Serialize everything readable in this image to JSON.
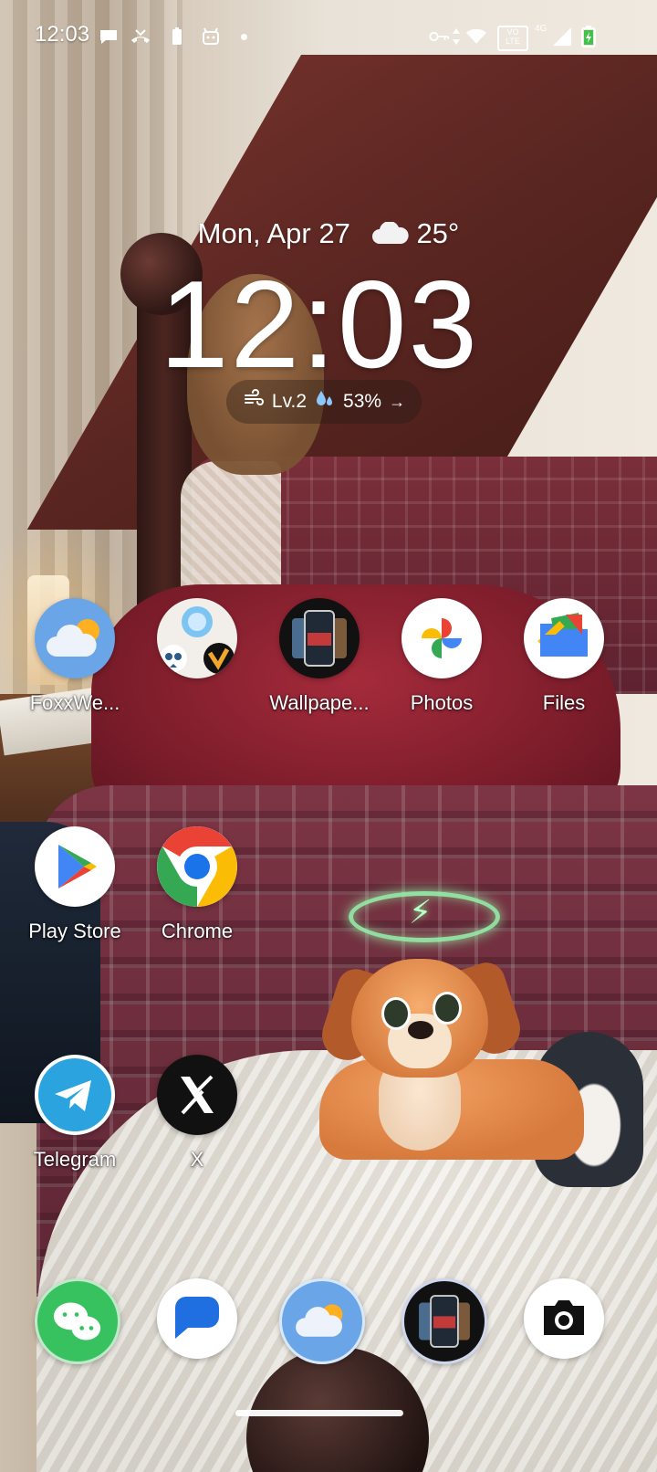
{
  "status_bar": {
    "time": "12:03",
    "icons": [
      "chat-bubble-icon",
      "missed-call-icon",
      "battery-saver-icon",
      "android-icon",
      "vpn-key-icon",
      "data-arrows-icon",
      "wifi-icon",
      "volte-icon",
      "4g-signal-icon",
      "battery-charging-icon"
    ],
    "volte_label": "VO\nLTE",
    "network_label": "4G"
  },
  "clock_widget": {
    "date": "Mon, Apr 27",
    "temperature": "25°",
    "time": "12:03",
    "wind_level": "Lv.2",
    "humidity": "53%",
    "weather_icon": "cloud-icon"
  },
  "apps": [
    {
      "name": "FoxxWe...",
      "icon": "weather-cloud-sun-icon"
    },
    {
      "name": "",
      "icon": "folder-cluster-icon"
    },
    {
      "name": "Wallpape...",
      "icon": "wallpaper-app-icon"
    },
    {
      "name": "Photos",
      "icon": "google-photos-icon"
    },
    {
      "name": "Files",
      "icon": "files-icon"
    },
    {
      "name": "Play Store",
      "icon": "play-store-icon"
    },
    {
      "name": "Chrome",
      "icon": "chrome-icon"
    },
    {
      "name": "Telegram",
      "icon": "telegram-icon"
    },
    {
      "name": "X",
      "icon": "x-logo-icon"
    }
  ],
  "dock": [
    {
      "icon": "wechat-icon"
    },
    {
      "icon": "messages-icon"
    },
    {
      "icon": "weather-cloud-sun-icon"
    },
    {
      "icon": "wallpaper-app-icon"
    },
    {
      "icon": "camera-icon"
    }
  ],
  "colors": {
    "foxx_weather_bg": "#6aa5e8",
    "telegram_blue": "#2aa3df",
    "wechat_green": "#37c25f",
    "messages_blue": "#1f6fe0"
  }
}
